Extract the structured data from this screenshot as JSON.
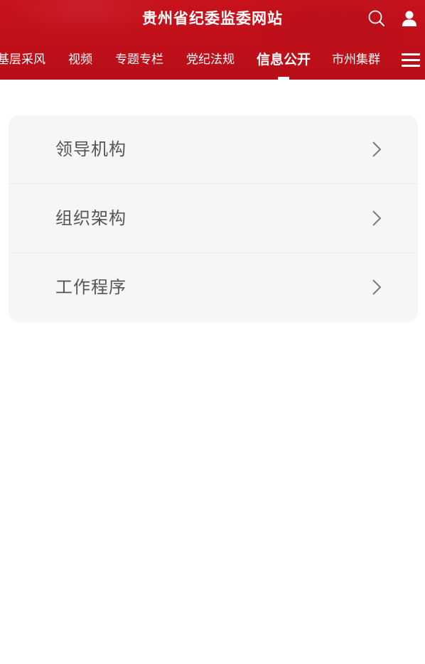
{
  "header": {
    "site_title": "贵州省纪委监委网站",
    "search_icon": "search-icon",
    "user_icon": "user-icon",
    "background_color": "#c8121c"
  },
  "nav": {
    "items": [
      {
        "label": "基层采风"
      },
      {
        "label": "视频"
      },
      {
        "label": "专题专栏"
      },
      {
        "label": "党纪法规"
      },
      {
        "label": "信息公开",
        "active": true
      },
      {
        "label": "市州集群"
      }
    ],
    "menu_icon": "menu-icon"
  },
  "list": {
    "items": [
      {
        "label": "领导机构"
      },
      {
        "label": "组织架构"
      },
      {
        "label": "工作程序"
      }
    ],
    "chevron_icon": "chevron-right-icon",
    "card_color": "#f6f6f6"
  }
}
